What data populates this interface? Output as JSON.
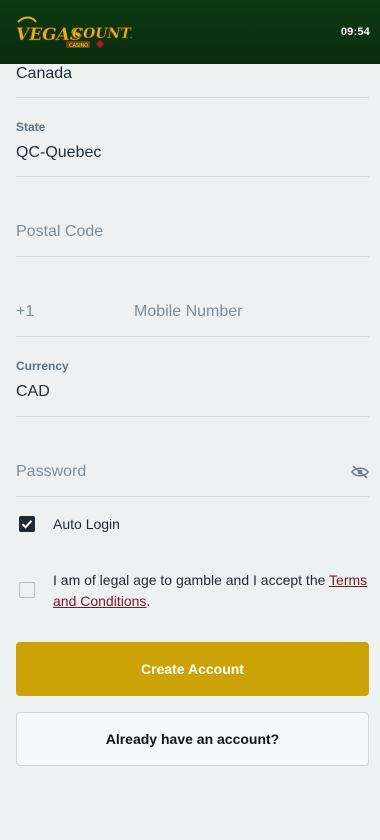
{
  "header": {
    "logo_text": "VEGAS COUNTRY",
    "logo_subtext": "CASINO",
    "time": "09:54",
    "colors": {
      "background": "#0b3310",
      "logo_gold": "#e2b42a",
      "logo_red": "#b51d1d"
    }
  },
  "form": {
    "country": {
      "value": "Canada"
    },
    "state": {
      "label": "State",
      "value": "QC-Quebec"
    },
    "postal_code": {
      "placeholder": "Postal Code"
    },
    "mobile": {
      "prefix": "+1",
      "placeholder": "Mobile Number"
    },
    "currency": {
      "label": "Currency",
      "value": "CAD"
    },
    "password": {
      "placeholder": "Password",
      "icon": "eye-off-icon"
    }
  },
  "options": {
    "auto_login": {
      "label": "Auto Login",
      "checked": true
    },
    "legal": {
      "checked": false,
      "text_before": "I am of legal age to gamble and I accept the ",
      "link_text": "Terms and Conditions",
      "text_after": "."
    }
  },
  "actions": {
    "create_account": "Create Account",
    "already_have_account": "Already have an account?"
  },
  "colors": {
    "page_bg": "#eef1f2",
    "primary_button": "#cca307",
    "link": "#7a1826",
    "divider": "#cfd6db"
  }
}
